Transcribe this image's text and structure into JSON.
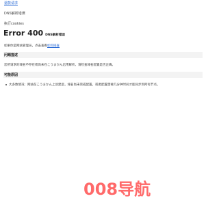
{
  "top_link": "退款请求",
  "line1": "DNS解析错误",
  "line2": "执行cookies",
  "error": {
    "title": "Error 400",
    "subtitle": "DNS解析错误"
  },
  "description": {
    "text": "如果你是网站管理员，点击查看",
    "link": "如何排查"
  },
  "section1": {
    "heading": "问题描述",
    "text": "您所请求的域名不存在或尚未在こうまかん启用解析，请检查域名配置是否正确。"
  },
  "section2": {
    "heading": "可能原因",
    "bullet": "大多数情况：网站在こうまかん上创建后，域名尚未完成配置，或者配置需要几分钟时间才能同步到所有节点。"
  },
  "logo": {
    "text": "008导航",
    "color": "#ff6a6a"
  }
}
